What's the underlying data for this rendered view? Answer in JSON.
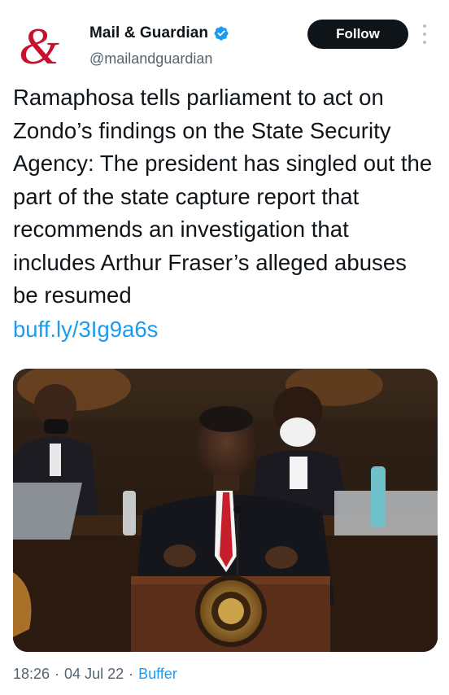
{
  "account": {
    "display_name": "Mail & Guardian",
    "handle": "@mailandguardian",
    "verified": true,
    "avatar_icon": "ampersand-logo-icon",
    "brand_color": "#c8102e"
  },
  "actions": {
    "follow_label": "Follow",
    "more_icon": "more-vertical-icon"
  },
  "tweet": {
    "text": "Ramaphosa tells parliament to act on Zondo’s findings on the State Security Agency: The president has singled out the part of the state capture report that recommends an investigation that includes Arthur Fraser’s alleged abuses be resumed",
    "link": "buff.ly/3Ig9a6s",
    "link_color": "#1d9bf0"
  },
  "media": {
    "type": "photo",
    "subject": "president-at-podium"
  },
  "meta": {
    "time": "18:26",
    "date": "04 Jul 22",
    "separator": "·",
    "source": "Buffer"
  }
}
